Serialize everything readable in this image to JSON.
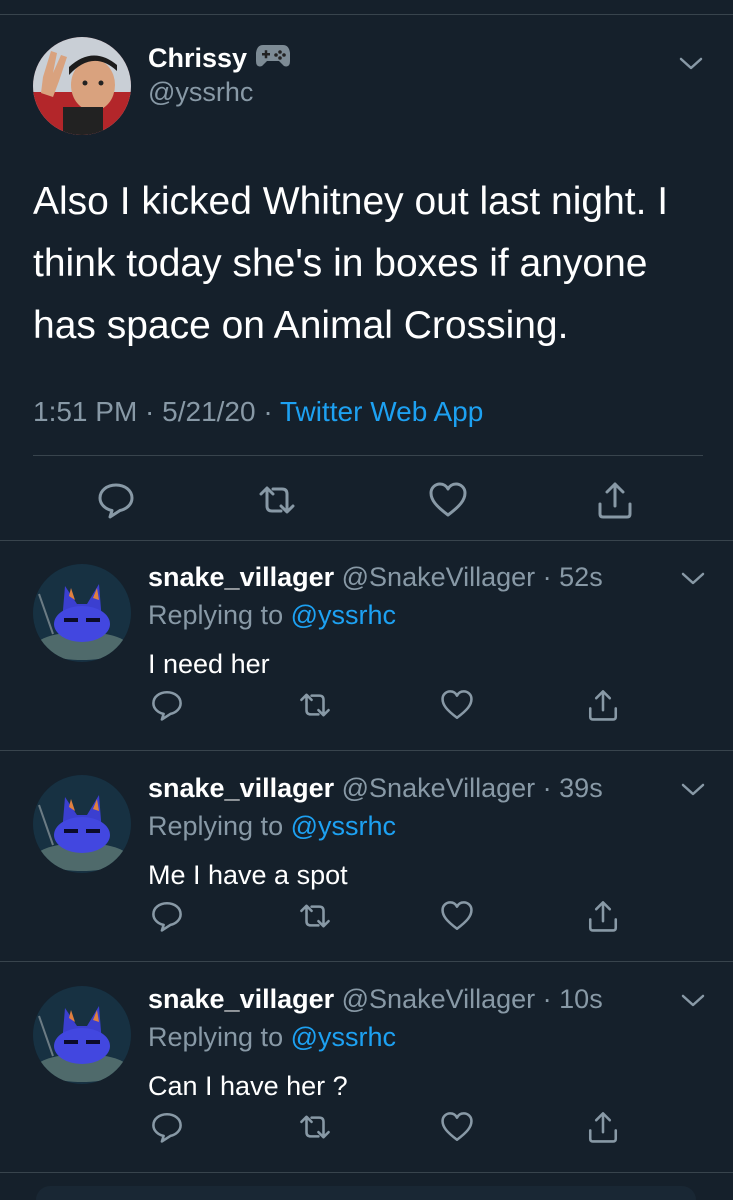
{
  "main_tweet": {
    "name": "Chrissy",
    "name_icon": "gamepad-icon",
    "handle": "@yssrhc",
    "text": "Also I kicked Whitney out last night. I think today she's in boxes if anyone has space on Animal Crossing.",
    "time": "1:51 PM · 5/21/20 · ",
    "source": "Twitter Web App"
  },
  "replies": [
    {
      "name": "snake_villager",
      "handle_time": " @SnakeVillager · 52s",
      "replying_prefix": "Replying to ",
      "replying_to": "@yssrhc",
      "text": "I need her"
    },
    {
      "name": "snake_villager",
      "handle_time": " @SnakeVillager · 39s",
      "replying_prefix": "Replying to ",
      "replying_to": "@yssrhc",
      "text": "Me I have a spot"
    },
    {
      "name": "snake_villager",
      "handle_time": " @SnakeVillager · 10s",
      "replying_prefix": "Replying to ",
      "replying_to": "@yssrhc",
      "text": "Can I have her ?"
    }
  ],
  "icons": {
    "reply": "reply-icon",
    "retweet": "retweet-icon",
    "like": "heart-icon",
    "share": "share-icon",
    "more": "chevron-down-icon"
  },
  "colors": {
    "background": "#15202b",
    "text": "#ffffff",
    "secondary": "#8899a6",
    "link": "#1da1f2",
    "divider": "#38444d"
  }
}
